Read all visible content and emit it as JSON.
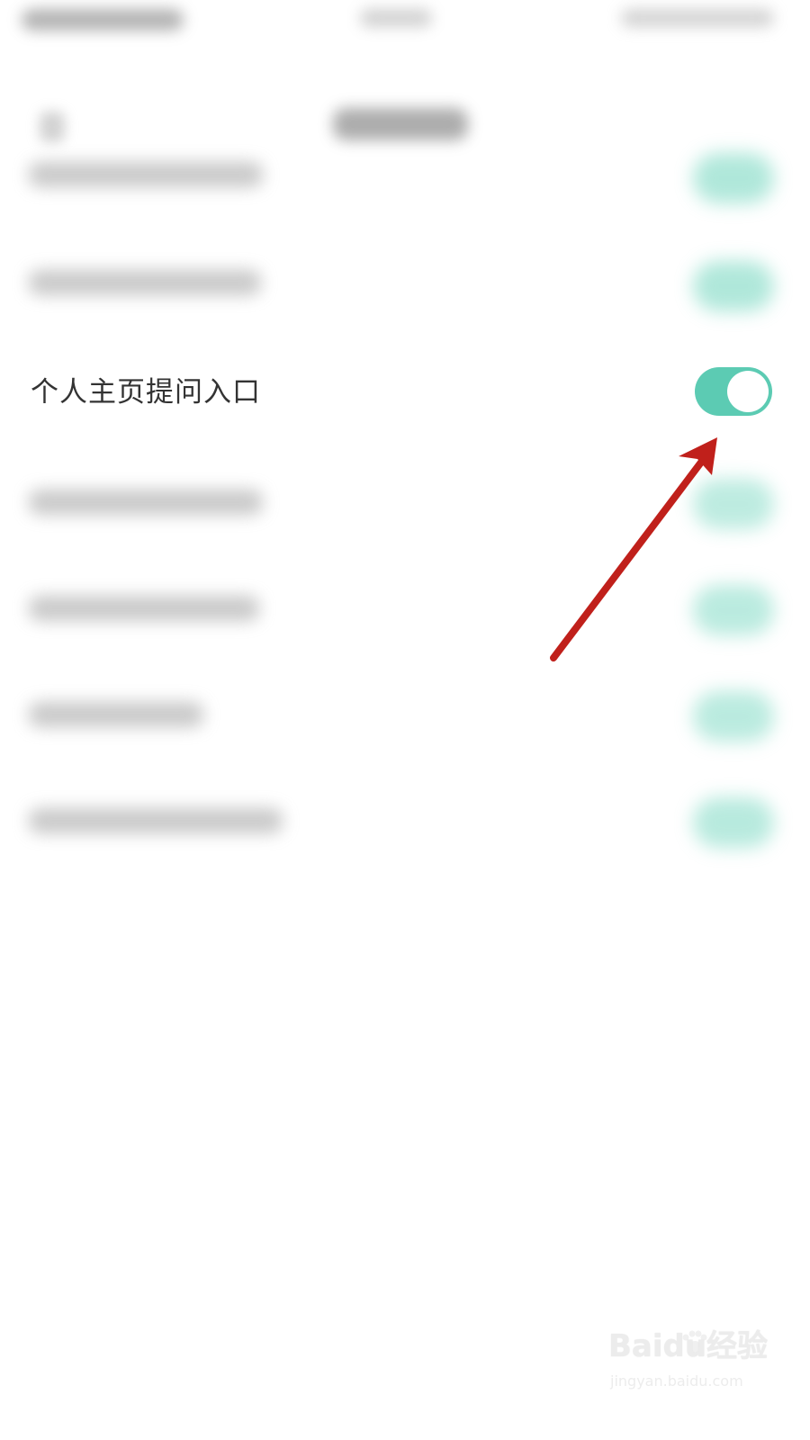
{
  "screen": {
    "status_bar": {
      "visible": true
    },
    "navigation_bar": {
      "visible": true
    },
    "settings_list": {
      "visible_setting_label": "个人主页提问入口",
      "toggle_enabled": true
    },
    "watermark": {
      "brand": "Baidu经验",
      "url": "jingyan.baidu.com"
    },
    "colors": {
      "toggle_on": "#5ccbb3",
      "arrow": "#c0201b",
      "text": "#333333"
    },
    "icons": {
      "arrow": "arrow-icon",
      "paw": "paw-icon"
    }
  }
}
